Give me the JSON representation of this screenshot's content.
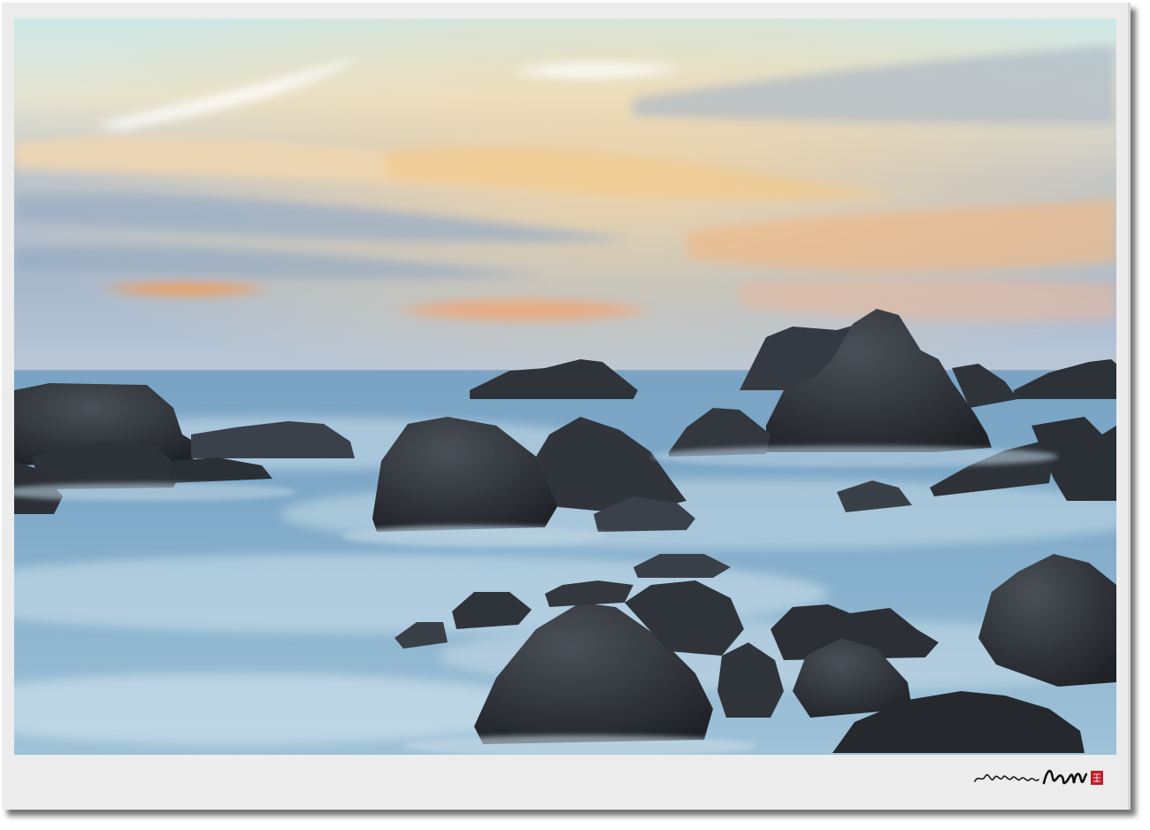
{
  "colors": {
    "frame": "#ececec",
    "sky_top": "#cfe7e6",
    "sky_mid": "#e8d3b0",
    "sky_glow": "#f0a36a",
    "sky_low": "#9fb5cc",
    "sea_far": "#6f9cc0",
    "sea_near": "#a7c8dc",
    "mist": "#c9dde8",
    "rock": "#2a2d33",
    "rock_light": "#4a4f58",
    "seal_red": "#c0202a"
  },
  "icons": {
    "signature": "calligraphy-signature-icon",
    "seal": "red-seal-stamp-icon"
  },
  "signature_text": "바다에서본세상 임현규"
}
